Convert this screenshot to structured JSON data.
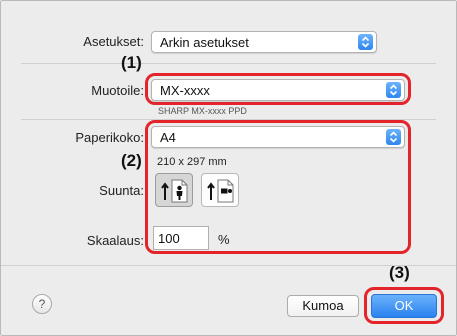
{
  "settings_row": {
    "label": "Asetukset:",
    "value": "Arkin asetukset"
  },
  "format_row": {
    "label": "Muotoile:",
    "value": "MX-xxxx",
    "sublabel": "SHARP MX-xxxx PPD"
  },
  "paper_row": {
    "label": "Paperikoko:",
    "value": "A4",
    "dimensions": "210 x 297 mm"
  },
  "orientation_row": {
    "label": "Suunta:",
    "options": [
      "portrait",
      "landscape"
    ],
    "selected": "portrait"
  },
  "scale_row": {
    "label": "Skaalaus:",
    "value": "100",
    "unit": "%"
  },
  "footer": {
    "help_symbol": "?",
    "cancel_label": "Kumoa",
    "ok_label": "OK"
  },
  "callouts": {
    "one": "(1)",
    "two": "(2)",
    "three": "(3)"
  },
  "colors": {
    "highlight": "#e3242b",
    "accent": "#2f86f0",
    "panel": "#ececec"
  },
  "icons": [
    "stepper-arrows-icon",
    "portrait-person-icon",
    "landscape-person-icon",
    "help-icon"
  ]
}
